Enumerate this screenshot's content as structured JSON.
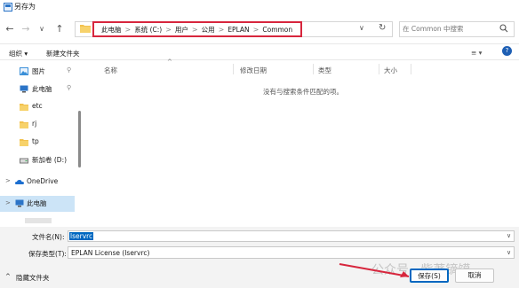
{
  "window": {
    "title": "另存为"
  },
  "nav": {
    "back": "←",
    "forward": "→",
    "dropdown": "∨",
    "up": "↑"
  },
  "address": {
    "crumbs": [
      "此电脑",
      "系统 (C:)",
      "用户",
      "公用",
      "EPLAN",
      "Common"
    ],
    "separator": ">",
    "refresh": "↻"
  },
  "search": {
    "placeholder": "在 Common 中搜索"
  },
  "toolbar": {
    "organize": "组织 ▾",
    "new_folder": "新建文件夹",
    "view": "≡ ▾",
    "help": "?"
  },
  "sidebar": {
    "items": [
      {
        "label": "图片",
        "icon": "pictures-icon",
        "pinned": true
      },
      {
        "label": "此电脑",
        "icon": "computer-icon",
        "pinned": true
      },
      {
        "label": "etc",
        "icon": "folder-icon",
        "pinned": false
      },
      {
        "label": "rj",
        "icon": "folder-icon",
        "pinned": false
      },
      {
        "label": "tp",
        "icon": "folder-icon",
        "pinned": false
      },
      {
        "label": "新加卷 (D:)",
        "icon": "drive-icon",
        "pinned": false
      },
      {
        "label": "OneDrive",
        "icon": "onedrive-icon",
        "pinned": false
      },
      {
        "label": "此电脑",
        "icon": "computer-icon",
        "pinned": false
      }
    ],
    "pin_glyph": "📌",
    "expand_glyph": ">"
  },
  "list": {
    "columns": [
      "名称",
      "修改日期",
      "类型",
      "大小"
    ],
    "empty_message": "没有与搜索条件匹配的项。",
    "sort_glyph": "^"
  },
  "form": {
    "filename_label": "文件名(N):",
    "filename_value": "lservrc",
    "filetype_label": "保存类型(T):",
    "filetype_value": "EPLAN License (lservrc)"
  },
  "footer": {
    "hide_folders": "隐藏文件夹",
    "save": "保存(S)",
    "cancel": "取消"
  },
  "watermark": {
    "text": "公众号 · 紫著镝馍"
  },
  "colors": {
    "accent": "#0067c0",
    "highlight_border": "#d7263d",
    "selection_bg": "#cce4f7"
  }
}
